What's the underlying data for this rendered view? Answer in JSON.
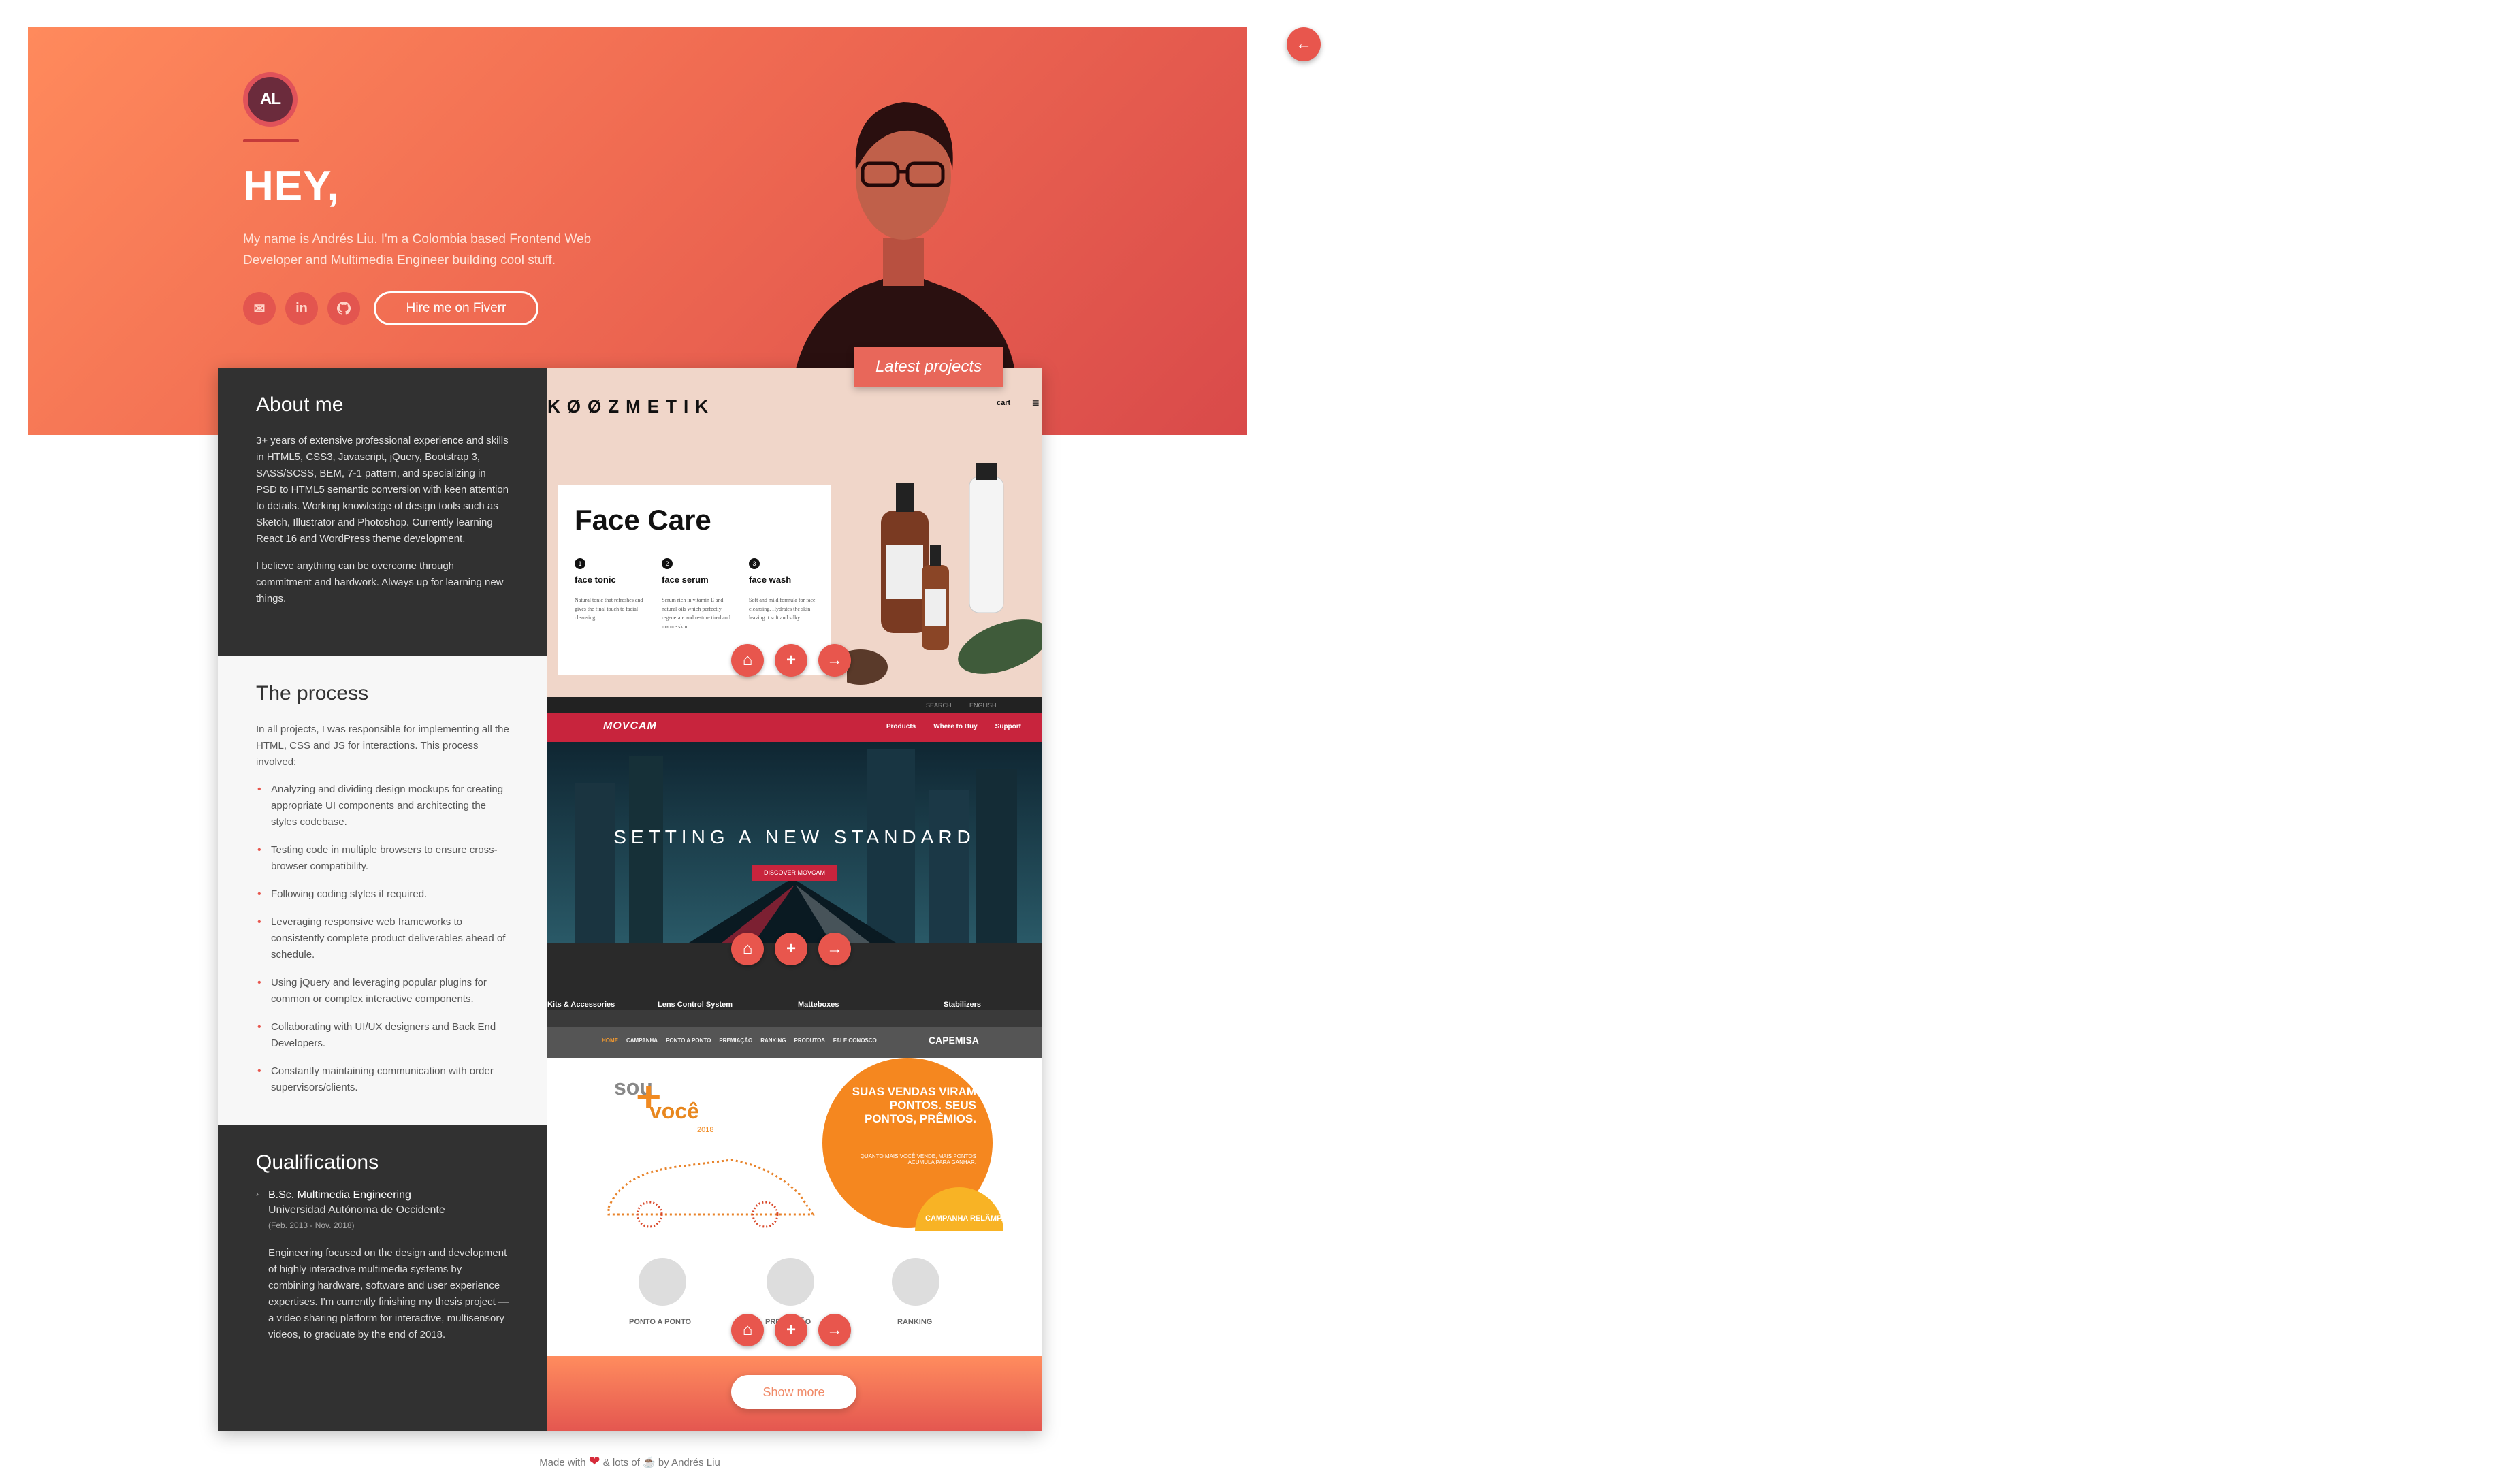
{
  "hero": {
    "logo_text": "AL",
    "greeting": "HEY,",
    "intro": "My name is Andrés Liu. I'm a Colombia based Frontend Web Developer and Multimedia Engineer building cool stuff.",
    "hire_label": "Hire me on Fiverr",
    "latest_label": "Latest projects"
  },
  "about": {
    "title": "About me",
    "p1": "3+ years of extensive professional experience and skills in HTML5, CSS3, Javascript, jQuery, Bootstrap 3, SASS/SCSS, BEM, 7-1 pattern, and specializing in PSD to HTML5 semantic conversion with keen attention to details. Working knowledge of design tools such as Sketch, Illustrator and Photoshop. Currently learning React 16 and WordPress theme development.",
    "p2": "I believe anything can be overcome through commitment and hardwork. Always up for learning new things."
  },
  "process": {
    "title": "The process",
    "intro": "In all projects, I was responsible for implementing all the HTML, CSS and JS for interactions. This process involved:",
    "items": [
      "Analyzing and dividing design mockups for creating appropriate UI components and architecting the styles codebase.",
      "Testing code in multiple browsers to ensure cross-browser compatibility.",
      "Following coding styles if required.",
      "Leveraging responsive web frameworks to consistently complete product deliverables ahead of schedule.",
      "Using jQuery and leveraging popular plugins for common or complex interactive components.",
      "Collaborating with UI/UX designers and Back End Developers.",
      "Constantly maintaining communication with order supervisors/clients."
    ]
  },
  "quals": {
    "title": "Qualifications",
    "degree": "B.Sc. Multimedia Engineering",
    "university": "Universidad Autónoma de Occidente",
    "dates": "(Feb. 2013 - Nov. 2018)",
    "desc": "Engineering focused on the design and development of highly interactive multimedia systems by combining hardware, software and user experience expertises. I'm currently finishing my thesis project — a video sharing platform for interactive, multisensory videos, to graduate by the end of 2018."
  },
  "koozmetik": {
    "brand": "KØØZMETIK",
    "cart": "cart",
    "title": "Face Care",
    "items": [
      {
        "num": "1",
        "name": "face tonic",
        "text": "Natural tonic that refreshes and gives the final touch to facial cleansing."
      },
      {
        "num": "2",
        "name": "face serum",
        "text": "Serum rich in vitamin E and natural oils which perfectly regenerate and restore tired and mature skin."
      },
      {
        "num": "3",
        "name": "face wash",
        "text": "Soft and mild formula for face cleansing. Hydrates the skin leaving it soft and silky."
      }
    ]
  },
  "movcam": {
    "top_search": "SEARCH",
    "top_lang": "ENGLISH",
    "logo": "MOVCAM",
    "nav": [
      "Products",
      "Where to Buy",
      "Support"
    ],
    "headline": "SETTING A NEW STANDARD",
    "cta": "DISCOVER MOVCAM",
    "captions": [
      "Kits & Accessories",
      "Lens Control System",
      "Matteboxes",
      "Stabilizers"
    ]
  },
  "capemisa": {
    "nav": [
      "HOME",
      "CAMPANHA",
      "PONTO A PONTO",
      "PREMIAÇÃO",
      "RANKING",
      "PRODUTOS",
      "FALE CONOSCO"
    ],
    "brand": "CAPEMISA",
    "sou": "sou",
    "voce": "você",
    "year": "2018",
    "headline": "SUAS VENDAS VIRAM PONTOS. SEUS PONTOS, PRÊMIOS.",
    "subtext": "QUANTO MAIS VOCÊ VENDE, MAIS PONTOS ACUMULA PARA GANHAR.",
    "flash": "CAMPANHA RELÂMPAGO",
    "icons": [
      "PONTO A PONTO",
      "PREMIAÇÃO",
      "RANKING"
    ]
  },
  "show_more": "Show more",
  "credit": {
    "before": "Made with",
    "middle": "& lots of",
    "after": "by Andrés Liu"
  },
  "colors": {
    "accent": "#e8564d",
    "dark": "#313131",
    "hero_start": "#ff8a5c",
    "hero_end": "#d94a4a"
  }
}
